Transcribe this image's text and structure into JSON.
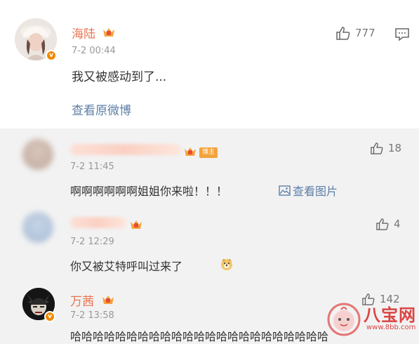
{
  "post": {
    "author": "海陆",
    "time": "7-2 00:44",
    "likes": "777",
    "text": "我又被感动到了...",
    "view_original": "查看原微博"
  },
  "comments": [
    {
      "time": "7-2 11:45",
      "likes": "18",
      "host_tag": "博主",
      "text": "啊啊啊啊啊啊姐姐你来啦！！！",
      "view_image": "查看图片"
    },
    {
      "time": "7-2 12:29",
      "likes": "4",
      "text": "你又被艾特呼叫过来了"
    },
    {
      "author": "万茜",
      "time": "7-2 13:58",
      "likes": "142",
      "text": "哈哈哈哈哈哈哈哈哈哈哈哈哈哈哈哈哈哈哈哈哈哈哈"
    }
  ],
  "watermark": {
    "brand": "八宝网",
    "url": "www.8bb.com"
  },
  "colors": {
    "username": "#eb7350",
    "link": "#5d7fa7",
    "vip_orange": "#f08a00",
    "background": "#f2f2f2"
  }
}
